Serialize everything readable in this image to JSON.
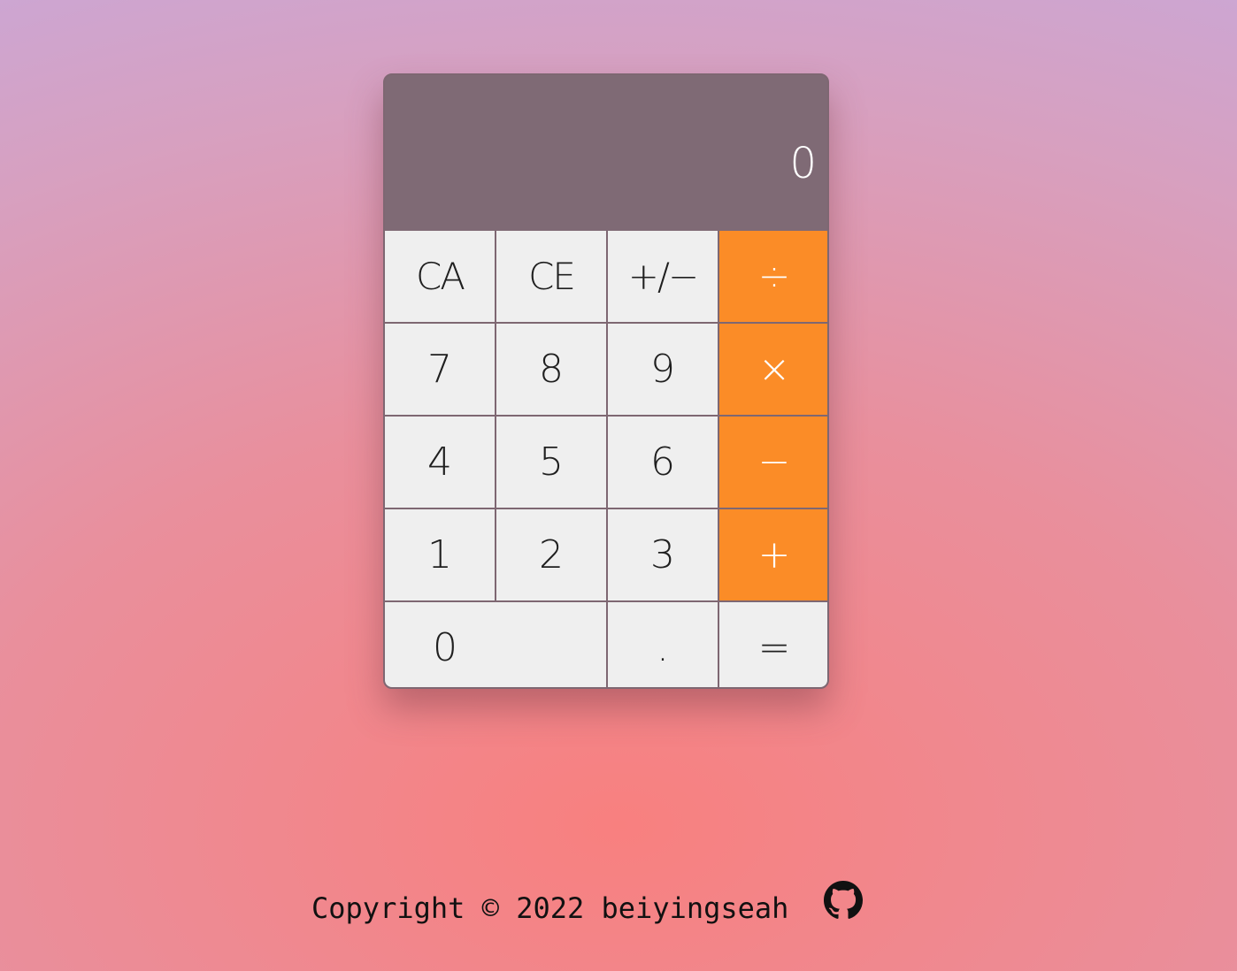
{
  "display": {
    "value": "0"
  },
  "keys": {
    "clear_all": "CA",
    "clear_entry": "CE",
    "negate": "+/−",
    "divide": "÷",
    "seven": "7",
    "eight": "8",
    "nine": "9",
    "multiply": "×",
    "four": "4",
    "five": "5",
    "six": "6",
    "subtract": "−",
    "one": "1",
    "two": "2",
    "three": "3",
    "add": "+",
    "zero": "0",
    "decimal": ".",
    "equals": "="
  },
  "footer": {
    "copyright": "Copyright © 2022 beiyingseah",
    "link_icon": "github-icon"
  },
  "colors": {
    "operator": "#fb8c27",
    "display_bg": "#7f6a75",
    "key_bg": "#efefef"
  }
}
